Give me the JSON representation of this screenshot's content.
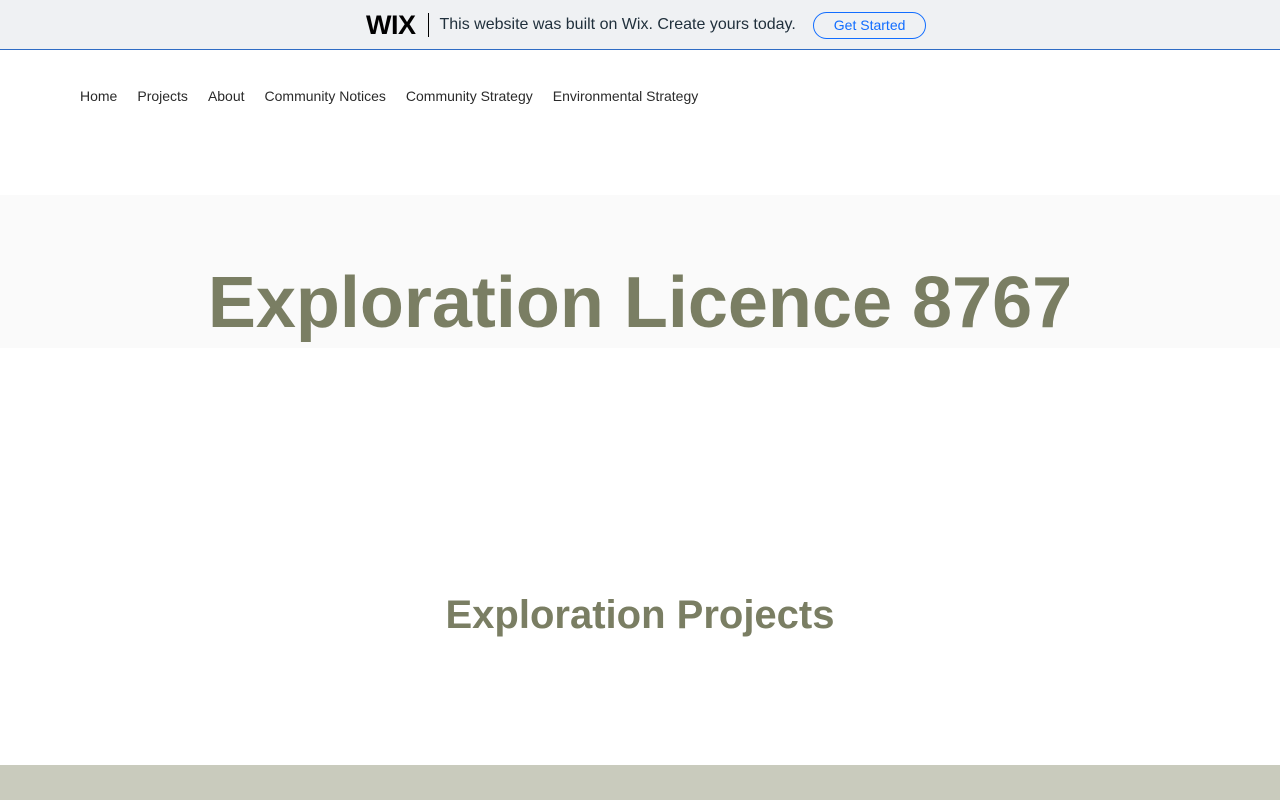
{
  "wix_banner": {
    "logo": "WIX",
    "tagline": "This website was built on Wix. Create yours today.",
    "cta_label": "Get Started"
  },
  "nav": {
    "items": [
      {
        "label": "Home"
      },
      {
        "label": "Projects"
      },
      {
        "label": "About"
      },
      {
        "label": "Community Notices"
      },
      {
        "label": "Community Strategy"
      },
      {
        "label": "Environmental Strategy"
      }
    ]
  },
  "hero": {
    "title": "Exploration Licence 8767"
  },
  "section": {
    "title": "Exploration Projects"
  },
  "colors": {
    "accent_text": "#7a7e63",
    "cta_blue": "#116dff",
    "footer": "#c9cbbd",
    "banner_bg": "#eff1f3"
  }
}
